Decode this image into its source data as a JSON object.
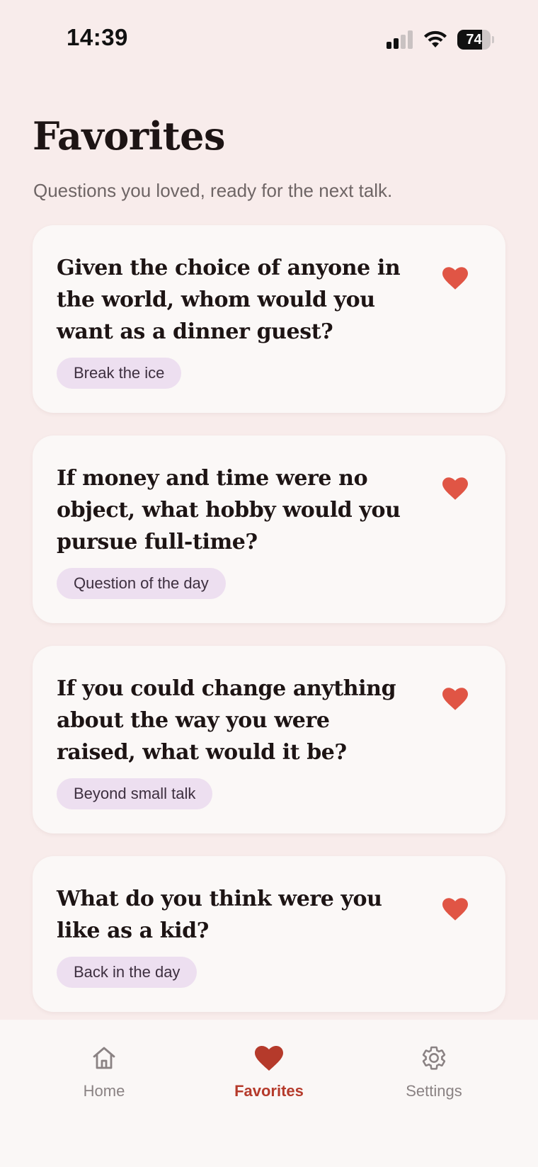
{
  "status_bar": {
    "time": "14:39",
    "battery_level": "74",
    "battery_fraction": 0.74,
    "signal_bars_active": 2,
    "signal_bars_total": 4
  },
  "header": {
    "title": "Favorites",
    "subtitle": "Questions you loved, ready for the next talk."
  },
  "favorites": [
    {
      "question": "Given the choice of anyone in the world, whom would you want as a dinner guest?",
      "tag": "Break the ice"
    },
    {
      "question": "If money and time were no object, what hobby would you pursue full-time?",
      "tag": "Question of the day"
    },
    {
      "question": "If you could change anything about the way you were raised, what would it be?",
      "tag": "Beyond small talk"
    },
    {
      "question": "What do you think were you like as a kid?",
      "tag": "Back in the day"
    }
  ],
  "nav": {
    "items": [
      {
        "label": "Home",
        "icon": "home-icon",
        "active": false
      },
      {
        "label": "Favorites",
        "icon": "heart-icon",
        "active": true
      },
      {
        "label": "Settings",
        "icon": "gear-icon",
        "active": false
      }
    ]
  },
  "colors": {
    "background": "#f8eceb",
    "card": "#fbf8f7",
    "heart": "#e05545",
    "nav_active": "#b53a2b",
    "tag_background": "#eddff0"
  }
}
